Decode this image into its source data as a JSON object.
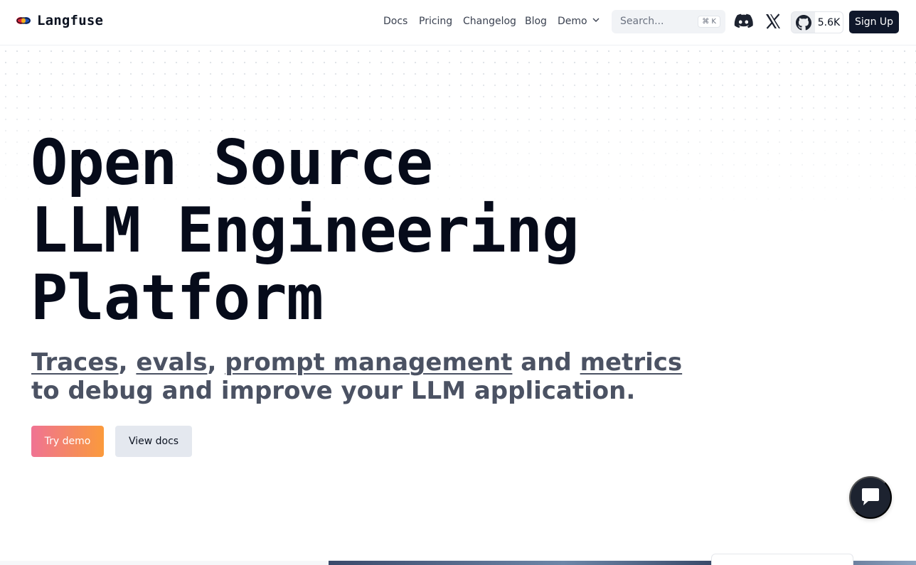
{
  "header": {
    "brand": "Langfuse",
    "nav": {
      "docs": "Docs",
      "pricing": "Pricing",
      "changelog": "Changelog",
      "blog": "Blog",
      "demo": "Demo"
    },
    "search": {
      "placeholder": "Search...",
      "shortcut": "⌘ K"
    },
    "github_stars": "5.6K",
    "signup_label": "Sign Up"
  },
  "hero": {
    "title_lines": [
      "Open Source",
      "LLM Engineering",
      "Platform"
    ],
    "subtitle": {
      "link_traces": "Traces",
      "sep1": ", ",
      "link_evals": "evals",
      "sep2": ", ",
      "link_prompt": "prompt management",
      "and": " and ",
      "link_metrics": "metrics",
      "line2": "to debug and improve your LLM application."
    },
    "cta_primary": "Try demo",
    "cta_secondary": "View docs"
  },
  "colors": {
    "primary_dark": "#0f172a",
    "cta_gradient_start": "#f07393",
    "cta_gradient_end": "#fb9a3c",
    "secondary_button": "#e4e8ef"
  },
  "icons": [
    "langfuse-logo-icon",
    "chevron-down-icon",
    "discord-icon",
    "x-icon",
    "github-icon",
    "chat-icon"
  ]
}
